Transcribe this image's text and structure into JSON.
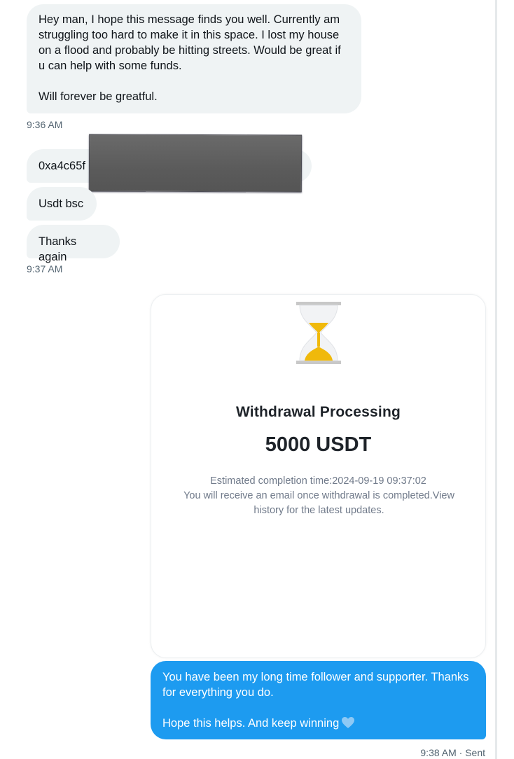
{
  "messages": {
    "received": [
      {
        "text": "Hey man, I hope this message finds you well. Currently am struggling too hard to make it in this space. I lost my house on a flood and probably be hitting streets. Would be great if u can help with some funds.\n\nWill forever be greatful."
      },
      {
        "text": "0xa4c65f"
      },
      {
        "text": "Usdt bsc"
      },
      {
        "text": "Thanks again"
      }
    ],
    "timestamps": {
      "first": "9:36 AM",
      "second": "9:37 AM",
      "sent": "9:38 AM · Sent"
    },
    "sent": {
      "text": "You have been my long time follower and supporter. Thanks for everything you do.\n\nHope this helps. And keep winning",
      "emoji_icon": "blue-heart-icon"
    }
  },
  "withdrawal_card": {
    "icon": "hourglass-icon",
    "title": "Withdrawal Processing",
    "amount": "5000 USDT",
    "estimate": "Estimated completion time:2024-09-19 09:37:02",
    "note": "You will receive an email once withdrawal is completed.View history for the latest updates."
  },
  "colors": {
    "received_bubble": "#eff3f4",
    "sent_bubble": "#1d9bf0",
    "timestamp": "#536471",
    "hourglass_sand": "#f0b90b",
    "hourglass_frame": "#c8c8c8"
  }
}
